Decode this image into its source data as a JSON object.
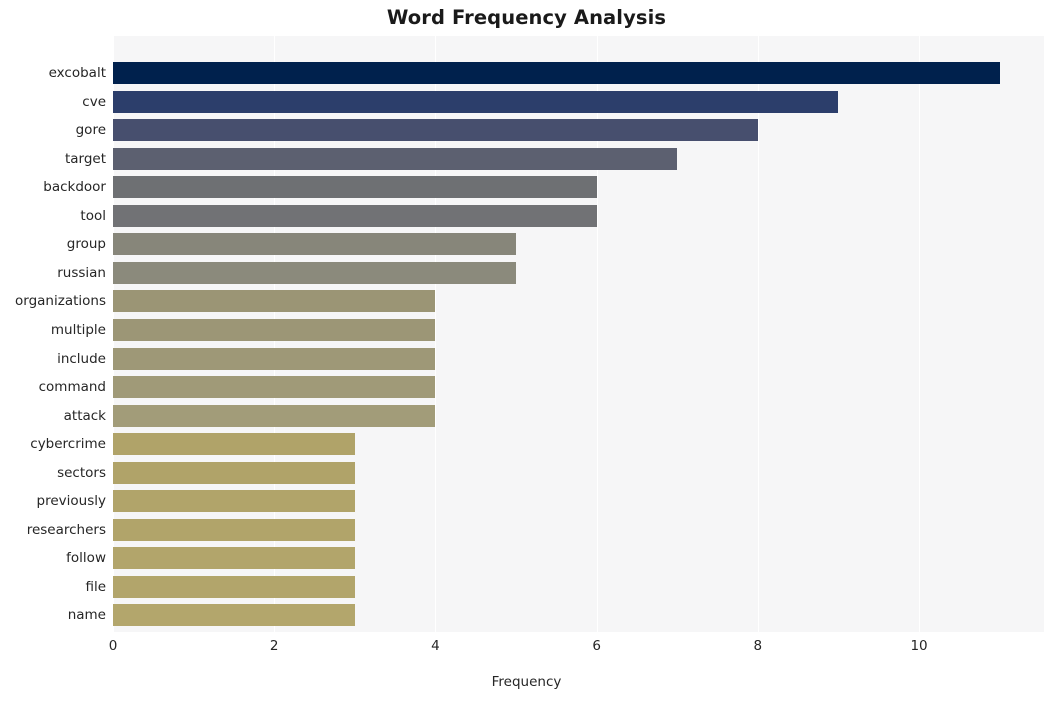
{
  "chart_data": {
    "type": "bar",
    "orientation": "horizontal",
    "title": "Word Frequency Analysis",
    "xlabel": "Frequency",
    "ylabel": "",
    "xlim": [
      0,
      11.55
    ],
    "xticks": [
      0,
      2,
      4,
      6,
      8,
      10
    ],
    "xtick_labels": [
      "0",
      "2",
      "4",
      "6",
      "8",
      "10"
    ],
    "grid": "vertical-only",
    "legend": "none",
    "categories": [
      "excobalt",
      "cve",
      "gore",
      "target",
      "backdoor",
      "tool",
      "group",
      "russian",
      "organizations",
      "multiple",
      "include",
      "command",
      "attack",
      "cybercrime",
      "sectors",
      "previously",
      "researchers",
      "follow",
      "file",
      "name"
    ],
    "values": [
      11,
      9,
      8,
      7,
      6,
      6,
      5,
      5,
      4,
      4,
      4,
      4,
      4,
      3,
      3,
      3,
      3,
      3,
      3,
      3
    ],
    "bar_colors": [
      "#00214d",
      "#2c3e6b",
      "#474f6e",
      "#5c6070",
      "#6e7073",
      "#717275",
      "#87867a",
      "#8b8a7c",
      "#9b9575",
      "#9c9676",
      "#9e9877",
      "#a09a78",
      "#a29c79",
      "#b0a369",
      "#b0a369",
      "#b1a46a",
      "#b1a46a",
      "#b2a56b",
      "#b2a56b",
      "#b3a66c"
    ],
    "colormap": "cividis",
    "plot_background": "#f6f6f7",
    "figure_background": "#ffffff",
    "gridline_color": "#ffffff",
    "text_color": "#262626",
    "title_color": "#1a1a1a"
  }
}
